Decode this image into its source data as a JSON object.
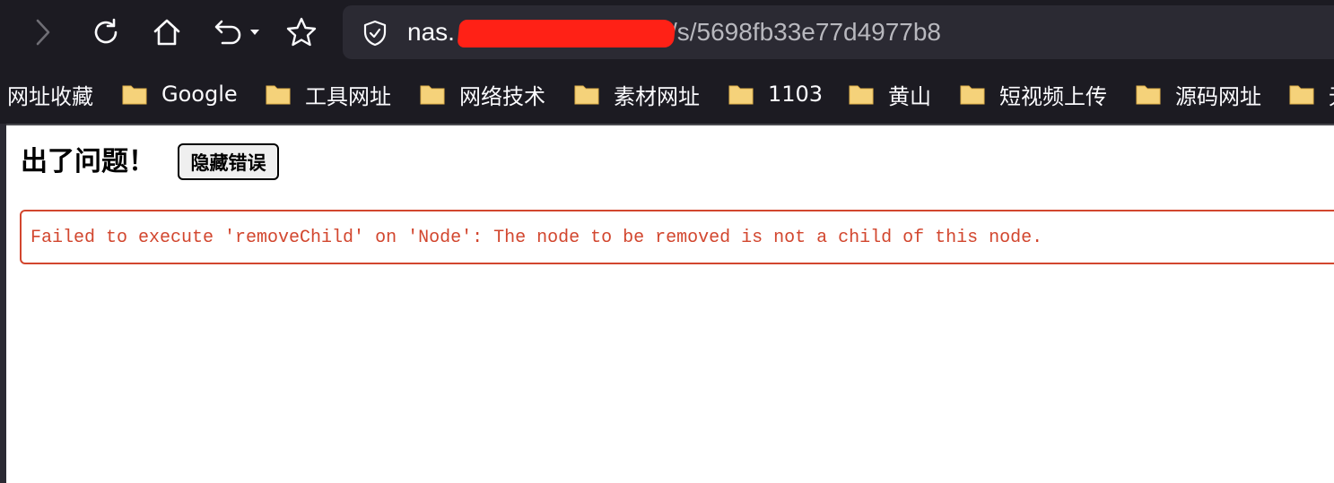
{
  "browser": {
    "nav_icons": [
      "forward-icon",
      "reload-icon",
      "home-icon",
      "undo-icon",
      "dropdown-arrow-icon",
      "star-icon"
    ],
    "url": {
      "host_prefix": "nas.",
      "path": "/s/5698fb33e77d4977b8"
    },
    "bookmarks": [
      {
        "label": "网址收藏",
        "icon": "none"
      },
      {
        "label": "Google",
        "icon": "folder-icon"
      },
      {
        "label": "工具网址",
        "icon": "folder-icon"
      },
      {
        "label": "网络技术",
        "icon": "folder-icon"
      },
      {
        "label": "素材网址",
        "icon": "folder-icon"
      },
      {
        "label": "1103",
        "icon": "folder-icon"
      },
      {
        "label": "黄山",
        "icon": "folder-icon"
      },
      {
        "label": "短视频上传",
        "icon": "folder-icon"
      },
      {
        "label": "源码网址",
        "icon": "folder-icon"
      },
      {
        "label": "无",
        "icon": "folder-icon"
      }
    ],
    "colors": {
      "toolbar_bg": "#1c1b22",
      "urlbar_bg": "#2b2a33",
      "folder": "#f5d27a",
      "redaction": "#ff2116"
    }
  },
  "page": {
    "error_title": "出了问题！",
    "hide_button_label": "隐藏错误",
    "error_message": "Failed to execute 'removeChild' on 'Node': The node to be removed is not a child of this node.",
    "colors": {
      "error": "#d2462e"
    }
  }
}
